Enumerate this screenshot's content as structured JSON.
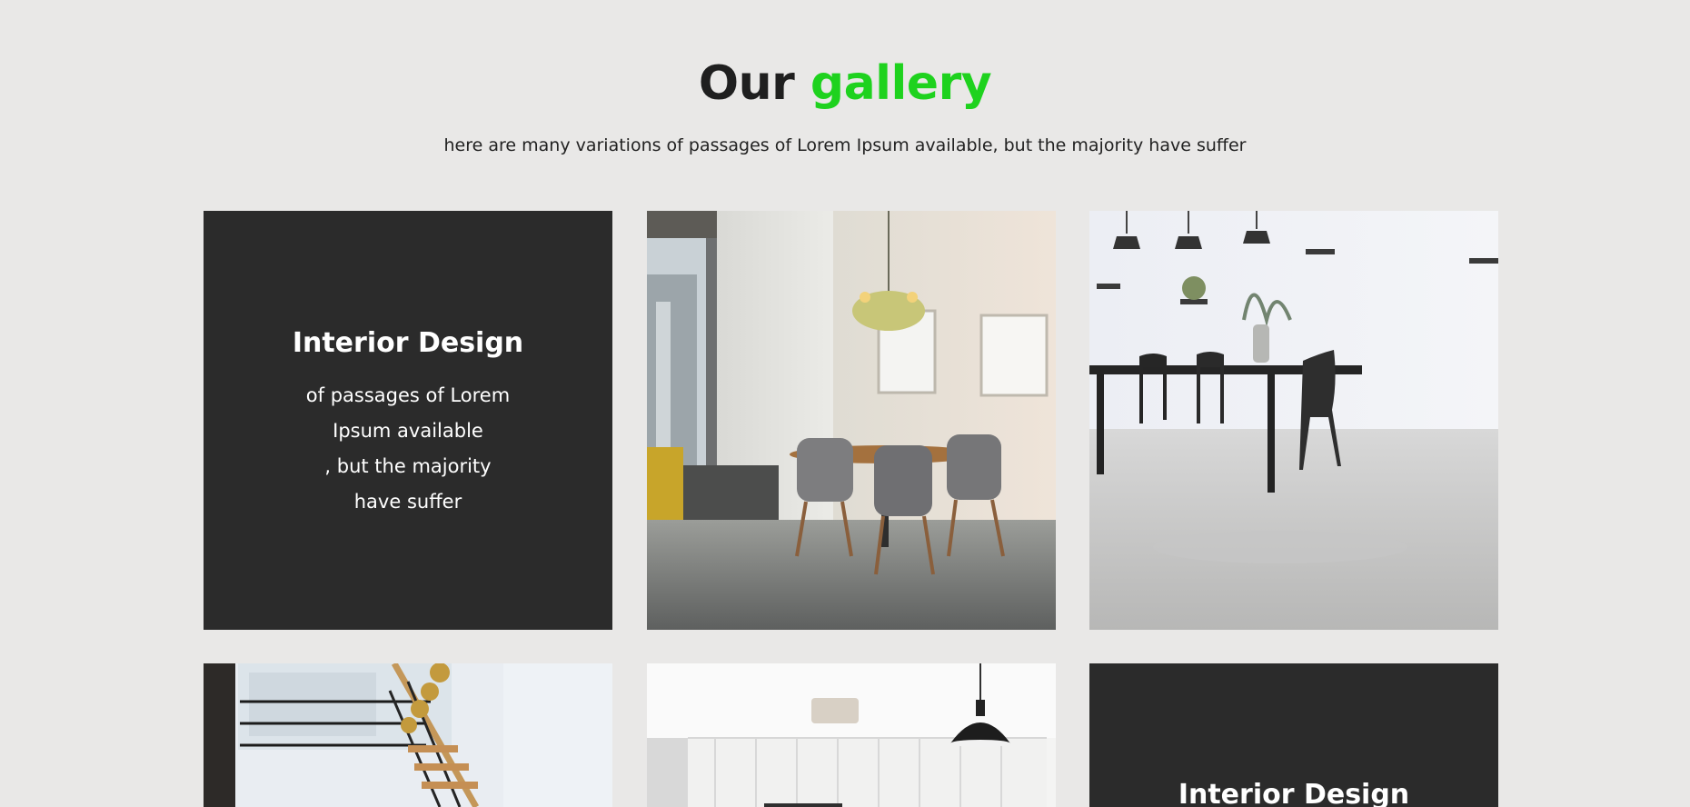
{
  "section": {
    "title_main": "Our",
    "title_accent": "gallery",
    "subtitle": "here are many variations of passages of Lorem Ipsum available, but the majority have suffer"
  },
  "cards": {
    "first": {
      "title": "Interior Design",
      "lines": [
        "of passages of Lorem",
        "Ipsum available",
        ", but the majority",
        "have suffer"
      ]
    },
    "last": {
      "title": "Interior Design"
    }
  },
  "colors": {
    "background": "#e9e8e7",
    "accent": "#1ed21e",
    "card": "#2b2b2b"
  },
  "icons": [
    "dining-room-photo",
    "dining-room-photo",
    "staircase-photo",
    "kitchen-photo"
  ]
}
